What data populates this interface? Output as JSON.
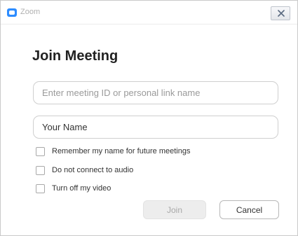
{
  "window": {
    "title": "Zoom",
    "close_icon": "close-x-icon",
    "app_icon": "zoom-camera-icon"
  },
  "dialog": {
    "heading": "Join Meeting",
    "meeting_id": {
      "value": "",
      "placeholder": "Enter meeting ID or personal link name"
    },
    "name": {
      "value": "Your Name",
      "placeholder": ""
    },
    "options": [
      {
        "label": "Remember my name for future meetings",
        "checked": false
      },
      {
        "label": "Do not connect to audio",
        "checked": false
      },
      {
        "label": "Turn off my video",
        "checked": false
      }
    ],
    "join_label": "Join",
    "join_enabled": false,
    "cancel_label": "Cancel"
  },
  "colors": {
    "accent": "#2d8cff",
    "disabled_button_bg": "#ededed",
    "disabled_button_text": "#a8a8a8"
  }
}
